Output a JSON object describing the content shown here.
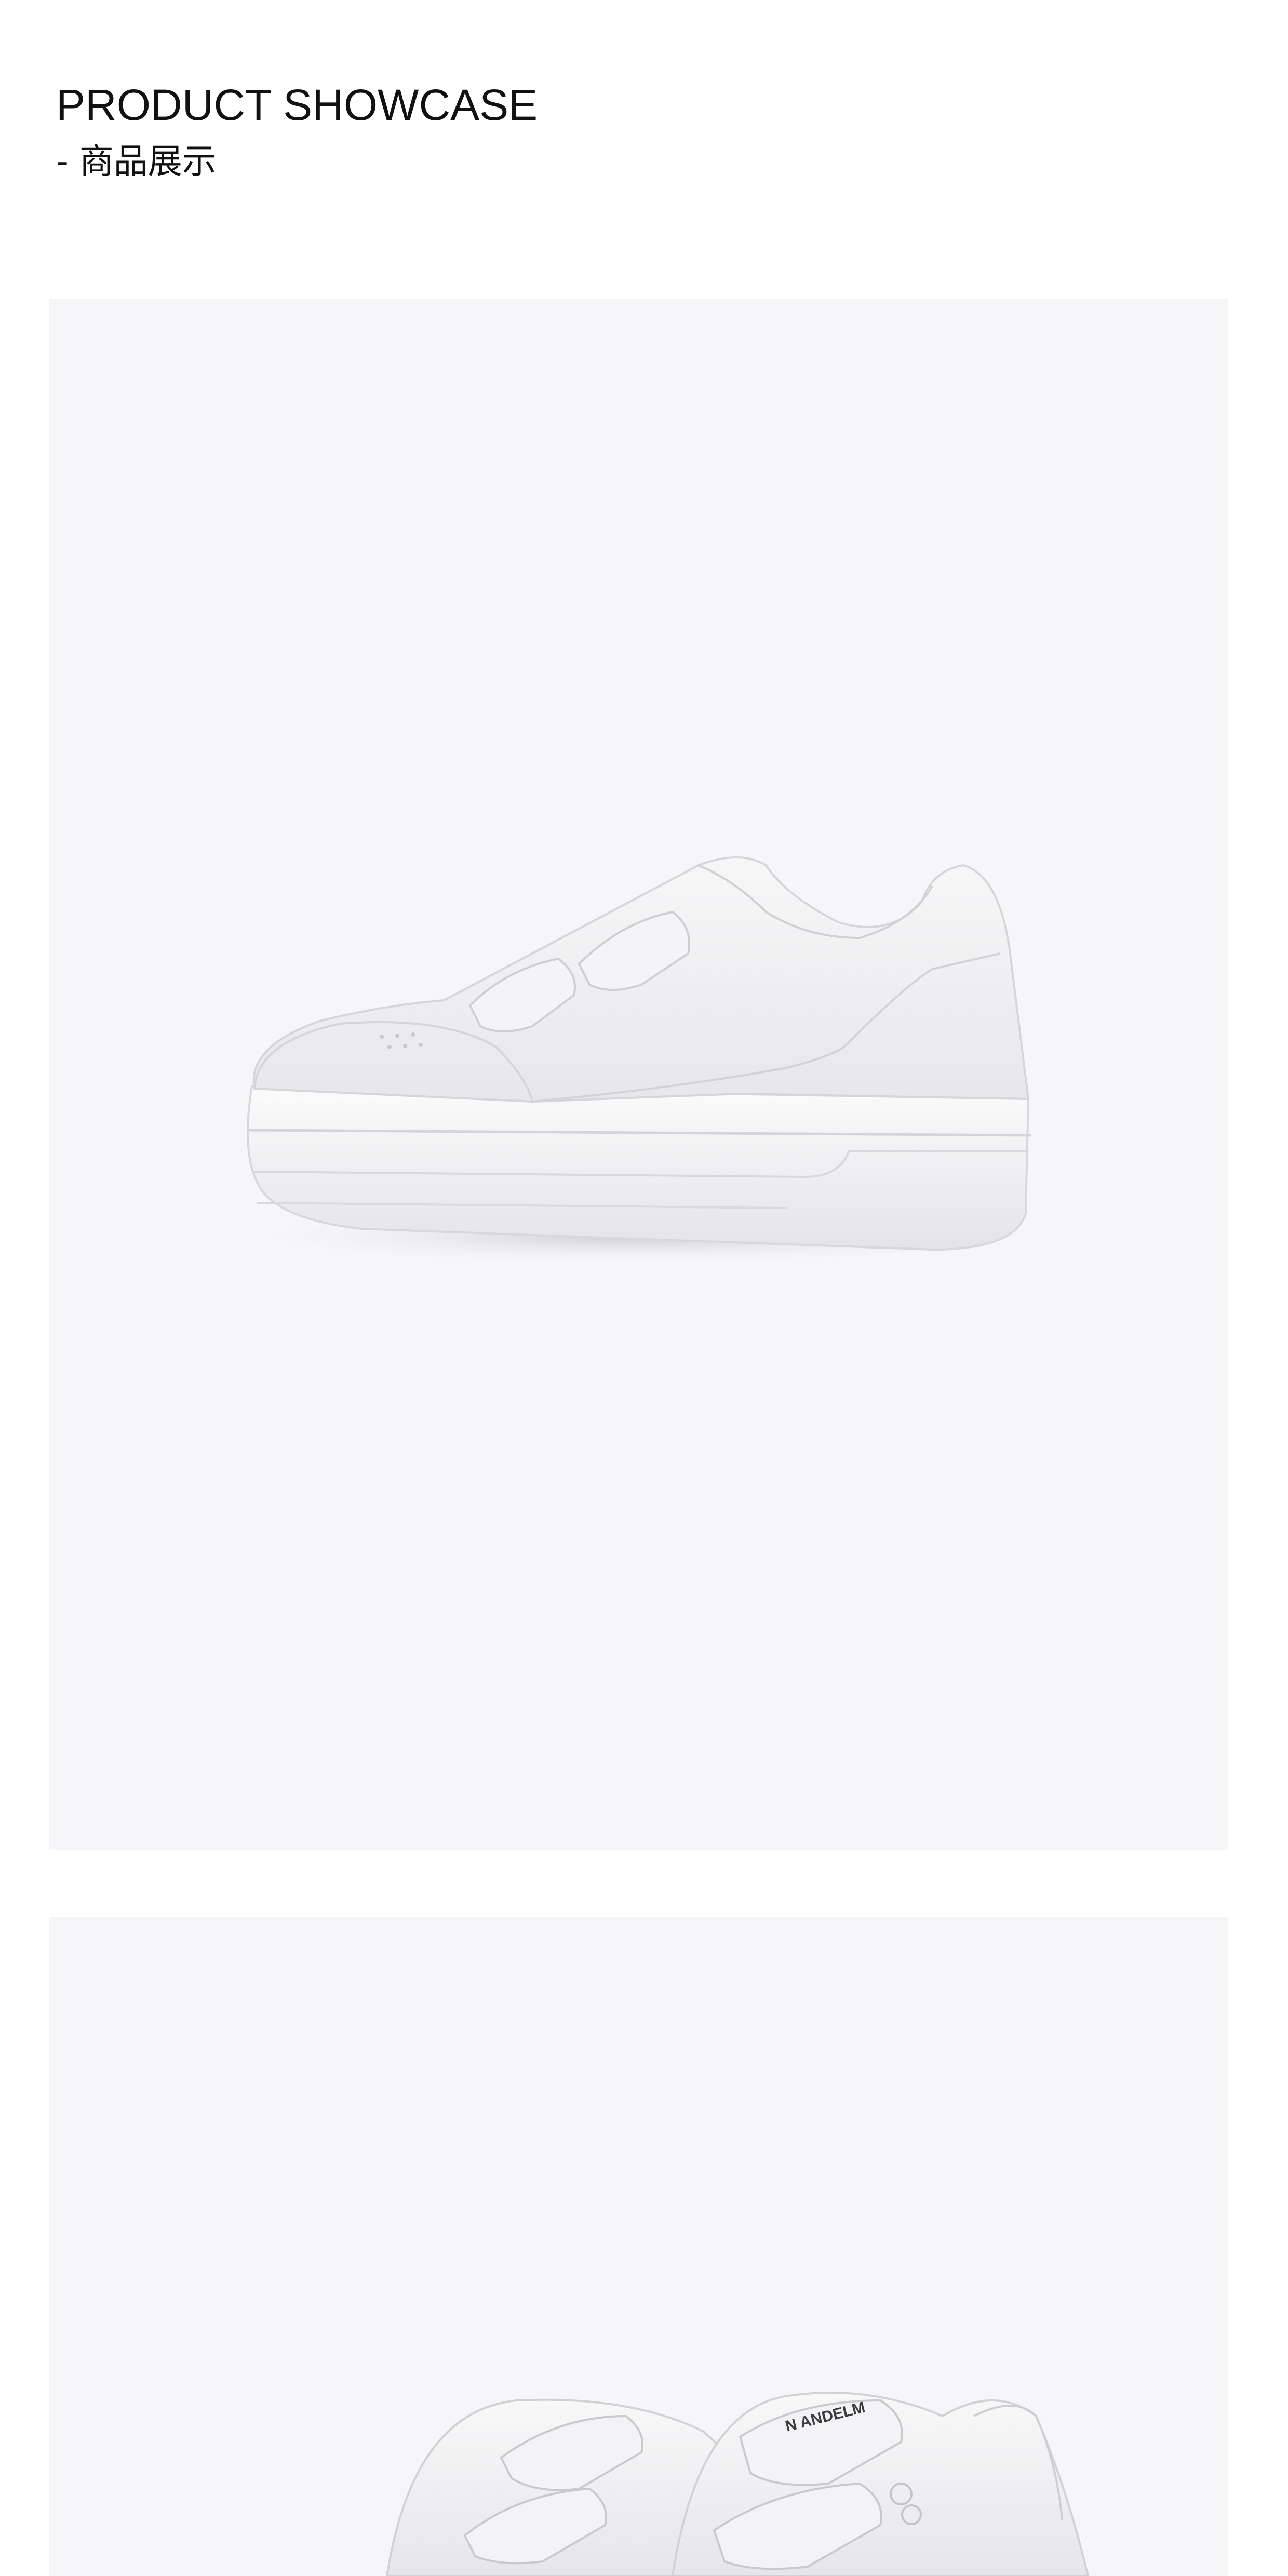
{
  "header": {
    "title_en": "PRODUCT SHOWCASE",
    "title_cn": "- 商品展示"
  },
  "showcase": {
    "images": [
      {
        "name": "white platform velcro sneaker side view"
      },
      {
        "name": "white platform velcro sneaker pair top view",
        "print": "N ANDELM"
      }
    ]
  },
  "colors": {
    "panel_bg": "#f6f6f8",
    "shoe": "#f2f2f3"
  }
}
